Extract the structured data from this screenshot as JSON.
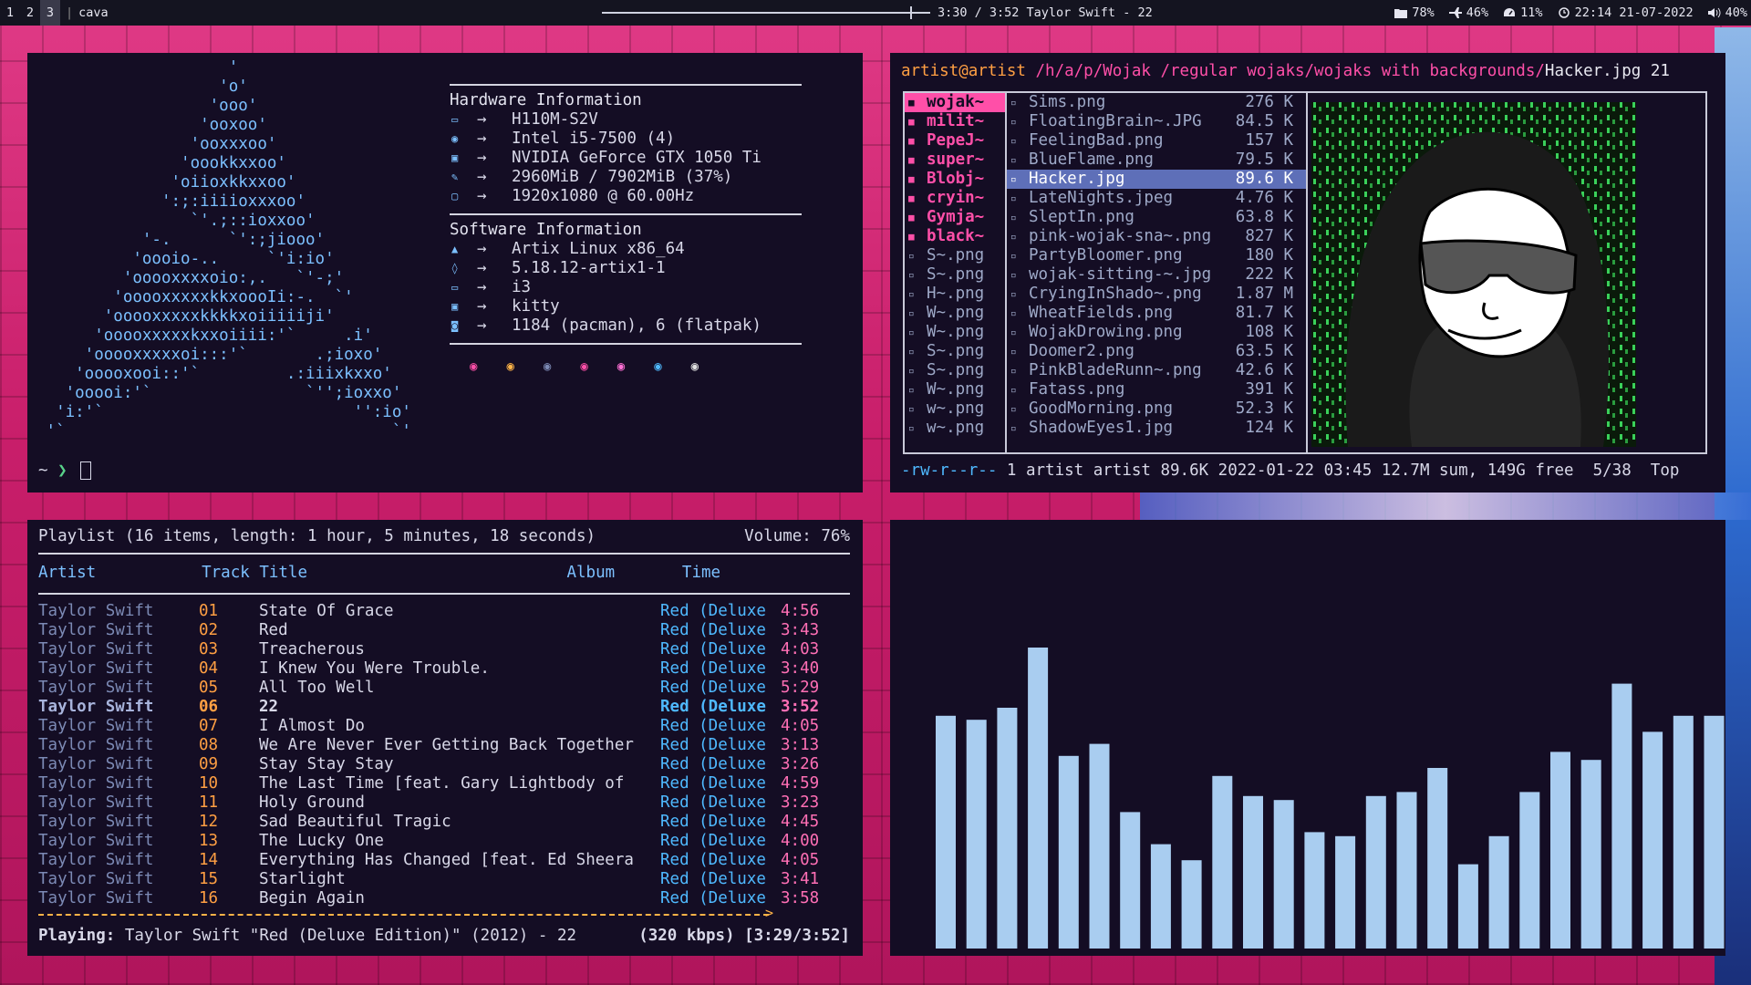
{
  "topbar": {
    "workspaces": [
      "1",
      "2",
      "3"
    ],
    "active_workspace": "3",
    "window_title": "cava",
    "song_progress_fraction": 0.94,
    "now_playing": "3:30 / 3:52 Taylor Swift - 22",
    "disk": "78%",
    "cpu": "46%",
    "ram": "11%",
    "clock": "22:14 21-07-2022",
    "volume": "40%"
  },
  "fetch": {
    "ascii": "                    '\n                   'o'\n                  'ooo'\n                 'ooxoo'\n                'ooxxxoo'\n               'oookkxxoo'\n              'oiioxkkxxoo'\n             ':;:iiiioxxxoo'\n                `'.;::ioxxoo'\n           '-.      `':;jiooo'\n          'oooio-..     `'i:io'\n         'ooooxxxxoio:,.   `'-;'\n        'ooooxxxxxkkxoooIi:-.  `'\n       'ooooxxxxxkkkkxoiiiiiji'\n      'ooooxxxxxkxxoiiii:'`     .i'\n     'ooooxxxxxoi:::'`       .;ioxo'\n    'ooooxooi::'`         .:iiixkxxo'\n   'ooooi:'`                `'';ioxxo'\n  'i:'`                          '':io'\n '`                                  `'",
    "hardware_title": "Hardware Information",
    "hardware": [
      {
        "icon": "laptop-icon",
        "value": "H110M-S2V"
      },
      {
        "icon": "cpu-icon",
        "value": "Intel i5-7500 (4)"
      },
      {
        "icon": "gpu-icon",
        "value": "NVIDIA GeForce GTX 1050 Ti"
      },
      {
        "icon": "memory-icon",
        "value": "2960MiB / 7902MiB (37%)"
      },
      {
        "icon": "monitor-icon",
        "value": "1920x1080 @ 60.00Hz"
      }
    ],
    "software_title": "Software Information",
    "software": [
      {
        "icon": "os-icon",
        "value": "Artix Linux x86_64"
      },
      {
        "icon": "kernel-icon",
        "value": "5.18.12-artix1-1"
      },
      {
        "icon": "wm-icon",
        "value": "i3"
      },
      {
        "icon": "terminal-icon",
        "value": "kitty"
      },
      {
        "icon": "package-icon",
        "value": "1184 (pacman), 6 (flatpak)"
      }
    ],
    "arrow": "→",
    "color_dots": [
      "#ff4fa8",
      "#ffb347",
      "#7c8ab5",
      "#ff4fa8",
      "#ff6fd5",
      "#4fb9ff",
      "#e0e0e0"
    ],
    "prompt_path": "~",
    "prompt_symbol": "❯"
  },
  "ranger": {
    "user_host": "artist@artist",
    "path": " /h/a/p/Wojak /regular wojaks/wojaks with backgrounds/",
    "file": "Hacker.jpg 21",
    "parent_dirs": [
      {
        "name": "wojak~",
        "type": "dir",
        "selected": true
      },
      {
        "name": "milit~",
        "type": "dir"
      },
      {
        "name": "PepeJ~",
        "type": "dir"
      },
      {
        "name": "super~",
        "type": "dir"
      },
      {
        "name": "Blobj~",
        "type": "dir"
      },
      {
        "name": "cryin~",
        "type": "dir"
      },
      {
        "name": "Gymja~",
        "type": "dir"
      },
      {
        "name": "black~",
        "type": "dir"
      },
      {
        "name": "S~.png",
        "type": "file"
      },
      {
        "name": "S~.png",
        "type": "file"
      },
      {
        "name": "H~.png",
        "type": "file"
      },
      {
        "name": "W~.png",
        "type": "file"
      },
      {
        "name": "W~.png",
        "type": "file"
      },
      {
        "name": "S~.png",
        "type": "file"
      },
      {
        "name": "S~.png",
        "type": "file"
      },
      {
        "name": "W~.png",
        "type": "file"
      },
      {
        "name": "w~.png",
        "type": "file"
      },
      {
        "name": "w~.png",
        "type": "file"
      }
    ],
    "files": [
      {
        "name": "Sims.png",
        "size": "276 K"
      },
      {
        "name": "FloatingBrain~.JPG",
        "size": "84.5 K"
      },
      {
        "name": "FeelingBad.png",
        "size": "157 K"
      },
      {
        "name": "BlueFlame.png",
        "size": "79.5 K"
      },
      {
        "name": "Hacker.jpg",
        "size": "89.6 K",
        "selected": true
      },
      {
        "name": "LateNights.jpeg",
        "size": "4.76 K"
      },
      {
        "name": "SleptIn.png",
        "size": "63.8 K"
      },
      {
        "name": "pink-wojak-sna~.png",
        "size": "827 K"
      },
      {
        "name": "PartyBloomer.png",
        "size": "180 K"
      },
      {
        "name": "wojak-sitting-~.jpg",
        "size": "222 K"
      },
      {
        "name": "CryingInShado~.png",
        "size": "1.87 M"
      },
      {
        "name": "WheatFields.png",
        "size": "81.7 K"
      },
      {
        "name": "WojakDrowing.png",
        "size": "108 K"
      },
      {
        "name": "Doomer2.png",
        "size": "63.5 K"
      },
      {
        "name": "PinkBladeRunn~.png",
        "size": "42.6 K"
      },
      {
        "name": "Fatass.png",
        "size": "391 K"
      },
      {
        "name": "GoodMorning.png",
        "size": "52.3 K"
      },
      {
        "name": "ShadowEyes1.jpg",
        "size": "124 K"
      }
    ],
    "status_perm": "-rw-r--r--",
    "status_rest": " 1 artist artist 89.6K 2022-01-22 03:45 12.7M sum, 149G free  5/38  Top"
  },
  "ncmpcpp": {
    "playlist_info": "Playlist (16 items, length: 1 hour, 5 minutes, 18 seconds)",
    "volume": "Volume: 76%",
    "columns": "Artist           Track Title                           Album       Time",
    "tracks": [
      {
        "artist": "Taylor Swift",
        "num": "01",
        "title": "State Of Grace",
        "album": "Red (Deluxe",
        "time": "4:56"
      },
      {
        "artist": "Taylor Swift",
        "num": "02",
        "title": "Red",
        "album": "Red (Deluxe",
        "time": "3:43"
      },
      {
        "artist": "Taylor Swift",
        "num": "03",
        "title": "Treacherous",
        "album": "Red (Deluxe",
        "time": "4:03"
      },
      {
        "artist": "Taylor Swift",
        "num": "04",
        "title": "I Knew You Were Trouble.",
        "album": "Red (Deluxe",
        "time": "3:40"
      },
      {
        "artist": "Taylor Swift",
        "num": "05",
        "title": "All Too Well",
        "album": "Red (Deluxe",
        "time": "5:29"
      },
      {
        "artist": "Taylor Swift",
        "num": "06",
        "title": "22",
        "album": "Red (Deluxe",
        "time": "3:52",
        "playing": true
      },
      {
        "artist": "Taylor Swift",
        "num": "07",
        "title": "I Almost Do",
        "album": "Red (Deluxe",
        "time": "4:05"
      },
      {
        "artist": "Taylor Swift",
        "num": "08",
        "title": "We Are Never Ever Getting Back Together",
        "album": "Red (Deluxe",
        "time": "3:13"
      },
      {
        "artist": "Taylor Swift",
        "num": "09",
        "title": "Stay Stay Stay",
        "album": "Red (Deluxe",
        "time": "3:26"
      },
      {
        "artist": "Taylor Swift",
        "num": "10",
        "title": "The Last Time [feat. Gary Lightbody of",
        "album": "Red (Deluxe",
        "time": "4:59"
      },
      {
        "artist": "Taylor Swift",
        "num": "11",
        "title": "Holy Ground",
        "album": "Red (Deluxe",
        "time": "3:23"
      },
      {
        "artist": "Taylor Swift",
        "num": "12",
        "title": "Sad Beautiful Tragic",
        "album": "Red (Deluxe",
        "time": "4:45"
      },
      {
        "artist": "Taylor Swift",
        "num": "13",
        "title": "The Lucky One",
        "album": "Red (Deluxe",
        "time": "4:00"
      },
      {
        "artist": "Taylor Swift",
        "num": "14",
        "title": "Everything Has Changed [feat. Ed Sheera",
        "album": "Red (Deluxe",
        "time": "4:05"
      },
      {
        "artist": "Taylor Swift",
        "num": "15",
        "title": "Starlight",
        "album": "Red (Deluxe",
        "time": "3:41"
      },
      {
        "artist": "Taylor Swift",
        "num": "16",
        "title": "Begin Again",
        "album": "Red (Deluxe",
        "time": "3:58"
      }
    ],
    "playing_label": "Playing:",
    "playing_text": " Taylor Swift \"Red (Deluxe Edition)\" (2012) - 22",
    "bitrate_time": "(320 kbps) [3:29/3:52]",
    "progress_fraction": 0.9
  },
  "cava": {
    "bar_color": "#a9cdf0",
    "levels": [
      0.58,
      0.57,
      0.6,
      0.75,
      0.48,
      0.51,
      0.34,
      0.26,
      0.22,
      0.43,
      0.38,
      0.37,
      0.29,
      0.28,
      0.38,
      0.39,
      0.45,
      0.21,
      0.28,
      0.39,
      0.49,
      0.47,
      0.66,
      0.54,
      0.58,
      0.58
    ]
  }
}
